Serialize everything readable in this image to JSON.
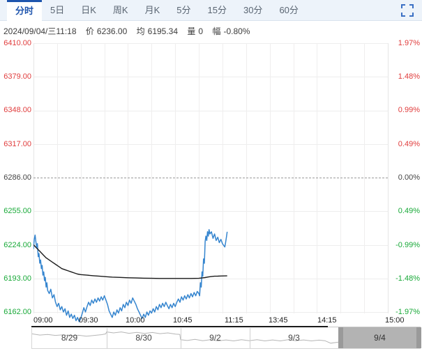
{
  "tab_bar": {
    "items": [
      {
        "label": "分时",
        "active": true
      },
      {
        "label": "5日",
        "active": false
      },
      {
        "label": "日K",
        "active": false
      },
      {
        "label": "周K",
        "active": false
      },
      {
        "label": "月K",
        "active": false
      },
      {
        "label": "5分",
        "active": false
      },
      {
        "label": "15分",
        "active": false
      },
      {
        "label": "30分",
        "active": false
      },
      {
        "label": "60分",
        "active": false
      }
    ]
  },
  "info_bar": {
    "datetime": "2024/09/04/三11:18",
    "price_label": "价",
    "price_value": "6236.00",
    "avg_label": "均",
    "avg_value": "6195.34",
    "volume_label": "量",
    "volume_value": "0",
    "range_label": "幅",
    "range_value": "-0.80%"
  },
  "colors": {
    "up": "#e03c3c",
    "down": "#18a938",
    "flat": "#444444",
    "price_line": "#3585cf",
    "avg_line": "#1a1a1a",
    "accent_blue": "#1f55ad",
    "tab_bar_bg": "#edf3fa",
    "nav_selected": "#b3b3b3",
    "nav_line": "#b5b5b5"
  },
  "chart_data": {
    "type": "line",
    "title": "",
    "x_ticks": [
      "09:00",
      "09:30",
      "10:00",
      "10:45",
      "11:15",
      "13:45",
      "14:15",
      "15:00"
    ],
    "tick_minutes": [
      0,
      30,
      60,
      90,
      120,
      150,
      180,
      225
    ],
    "x_total_trading_minutes": 225,
    "grid_interval_minutes": 15,
    "ylim": [
      6162,
      6410
    ],
    "base_price": 6286.0,
    "y_axis_prices": [
      {
        "value": "6410.00",
        "color": "#e03c3c"
      },
      {
        "value": "6379.00",
        "color": "#e03c3c"
      },
      {
        "value": "6348.00",
        "color": "#e03c3c"
      },
      {
        "value": "6317.00",
        "color": "#e03c3c"
      },
      {
        "value": "6286.00",
        "color": "#444444"
      },
      {
        "value": "6255.00",
        "color": "#18a938"
      },
      {
        "value": "6224.00",
        "color": "#18a938"
      },
      {
        "value": "6193.00",
        "color": "#18a938"
      },
      {
        "value": "6162.00",
        "color": "#18a938"
      }
    ],
    "y_axis_percents": [
      {
        "value": "1.97%",
        "color": "#e03c3c"
      },
      {
        "value": "1.48%",
        "color": "#e03c3c"
      },
      {
        "value": "0.99%",
        "color": "#e03c3c"
      },
      {
        "value": "0.49%",
        "color": "#e03c3c"
      },
      {
        "value": "0.00%",
        "color": "#444444"
      },
      {
        "value": "0.49%",
        "color": "#18a938"
      },
      {
        "value": "-0.99%",
        "color": "#18a938"
      },
      {
        "value": "-1.48%",
        "color": "#18a938"
      },
      {
        "value": "-1.97%",
        "color": "#18a938"
      }
    ],
    "current": {
      "time": "11:18",
      "price": 6236.0,
      "average": 6195.34,
      "volume": 0,
      "change_pct": -0.8
    },
    "series": [
      {
        "name": "price",
        "color": "#3585cf",
        "width": 1.5,
        "points": [
          [
            0,
            6220
          ],
          [
            0.5,
            6229
          ],
          [
            1,
            6233
          ],
          [
            1.5,
            6227
          ],
          [
            2,
            6222
          ],
          [
            2.5,
            6225
          ],
          [
            3,
            6213
          ],
          [
            3.5,
            6216
          ],
          [
            4,
            6207
          ],
          [
            4.5,
            6210
          ],
          [
            5,
            6202
          ],
          [
            5.5,
            6205
          ],
          [
            6,
            6196
          ],
          [
            6.5,
            6199
          ],
          [
            7,
            6191
          ],
          [
            7.5,
            6194
          ],
          [
            8,
            6185
          ],
          [
            8.5,
            6189
          ],
          [
            9,
            6182
          ],
          [
            10,
            6179
          ],
          [
            11,
            6183
          ],
          [
            12,
            6175
          ],
          [
            13,
            6178
          ],
          [
            14,
            6171
          ],
          [
            15,
            6167
          ],
          [
            16,
            6170
          ],
          [
            17,
            6164
          ],
          [
            18,
            6167
          ],
          [
            19,
            6162
          ],
          [
            20,
            6165
          ],
          [
            21,
            6159
          ],
          [
            22,
            6163
          ],
          [
            23,
            6157
          ],
          [
            24,
            6160
          ],
          [
            25,
            6156
          ],
          [
            26,
            6159
          ],
          [
            27,
            6154
          ],
          [
            28,
            6157
          ],
          [
            29,
            6153
          ],
          [
            30,
            6156
          ],
          [
            31,
            6161
          ],
          [
            32,
            6166
          ],
          [
            33,
            6162
          ],
          [
            34,
            6167
          ],
          [
            35,
            6171
          ],
          [
            36,
            6168
          ],
          [
            37,
            6173
          ],
          [
            38,
            6170
          ],
          [
            39,
            6174
          ],
          [
            40,
            6171
          ],
          [
            41,
            6175
          ],
          [
            42,
            6172
          ],
          [
            43,
            6176
          ],
          [
            44,
            6173
          ],
          [
            45,
            6177
          ],
          [
            46,
            6173
          ],
          [
            47,
            6169
          ],
          [
            48,
            6163
          ],
          [
            49,
            6160
          ],
          [
            50,
            6157
          ],
          [
            51,
            6162
          ],
          [
            52,
            6159
          ],
          [
            53,
            6164
          ],
          [
            54,
            6161
          ],
          [
            55,
            6166
          ],
          [
            56,
            6163
          ],
          [
            57,
            6169
          ],
          [
            58,
            6166
          ],
          [
            59,
            6171
          ],
          [
            60,
            6168
          ],
          [
            61,
            6173
          ],
          [
            62,
            6170
          ],
          [
            63,
            6175
          ],
          [
            64,
            6172
          ],
          [
            65,
            6169
          ],
          [
            66,
            6165
          ],
          [
            67,
            6162
          ],
          [
            68,
            6159
          ],
          [
            69,
            6156
          ],
          [
            70,
            6160
          ],
          [
            71,
            6157
          ],
          [
            72,
            6162
          ],
          [
            73,
            6159
          ],
          [
            74,
            6163
          ],
          [
            75,
            6161
          ],
          [
            76,
            6165
          ],
          [
            77,
            6162
          ],
          [
            78,
            6167
          ],
          [
            79,
            6164
          ],
          [
            80,
            6169
          ],
          [
            81,
            6166
          ],
          [
            82,
            6170
          ],
          [
            83,
            6167
          ],
          [
            84,
            6171
          ],
          [
            85,
            6168
          ],
          [
            86,
            6165
          ],
          [
            87,
            6169
          ],
          [
            88,
            6166
          ],
          [
            89,
            6170
          ],
          [
            90,
            6167
          ],
          [
            91,
            6171
          ],
          [
            92,
            6174
          ],
          [
            93,
            6171
          ],
          [
            94,
            6176
          ],
          [
            95,
            6173
          ],
          [
            96,
            6177
          ],
          [
            97,
            6174
          ],
          [
            98,
            6178
          ],
          [
            99,
            6175
          ],
          [
            100,
            6179
          ],
          [
            101,
            6176
          ],
          [
            102,
            6180
          ],
          [
            103,
            6177
          ],
          [
            104,
            6181
          ],
          [
            105,
            6179
          ],
          [
            105.5,
            6177
          ],
          [
            106,
            6189
          ],
          [
            106.5,
            6185
          ],
          [
            107,
            6199
          ],
          [
            107.5,
            6195
          ],
          [
            108,
            6211
          ],
          [
            108.5,
            6207
          ],
          [
            109,
            6227
          ],
          [
            109.5,
            6232
          ],
          [
            110,
            6228
          ],
          [
            110.5,
            6236
          ],
          [
            111,
            6232
          ],
          [
            111.5,
            6238
          ],
          [
            112,
            6234
          ],
          [
            113,
            6236
          ],
          [
            114,
            6230
          ],
          [
            115,
            6234
          ],
          [
            116,
            6228
          ],
          [
            117,
            6231
          ],
          [
            118,
            6226
          ],
          [
            119,
            6229
          ],
          [
            120,
            6225
          ],
          [
            121,
            6223
          ],
          [
            121.5,
            6222
          ],
          [
            122,
            6226
          ],
          [
            122.5,
            6231
          ],
          [
            123,
            6236
          ]
        ]
      },
      {
        "name": "average",
        "color": "#1a1a1a",
        "width": 1.4,
        "points": [
          [
            0,
            6224
          ],
          [
            2,
            6221
          ],
          [
            4,
            6218
          ],
          [
            6,
            6215
          ],
          [
            8,
            6212
          ],
          [
            10,
            6210
          ],
          [
            12,
            6208
          ],
          [
            14,
            6206
          ],
          [
            16,
            6204
          ],
          [
            18,
            6202
          ],
          [
            20,
            6201
          ],
          [
            22,
            6200
          ],
          [
            24,
            6199
          ],
          [
            26,
            6198
          ],
          [
            28,
            6197
          ],
          [
            30,
            6196.5
          ],
          [
            34,
            6196
          ],
          [
            38,
            6195.5
          ],
          [
            42,
            6195
          ],
          [
            46,
            6194.6
          ],
          [
            50,
            6194.2
          ],
          [
            55,
            6193.9
          ],
          [
            60,
            6193.6
          ],
          [
            65,
            6193.4
          ],
          [
            70,
            6193.2
          ],
          [
            75,
            6193.1
          ],
          [
            80,
            6193
          ],
          [
            85,
            6193
          ],
          [
            90,
            6193
          ],
          [
            95,
            6193
          ],
          [
            100,
            6193
          ],
          [
            105,
            6193.1
          ],
          [
            107,
            6193.4
          ],
          [
            109,
            6193.8
          ],
          [
            111,
            6194.3
          ],
          [
            113,
            6194.7
          ],
          [
            115,
            6195
          ],
          [
            117,
            6195.1
          ],
          [
            119,
            6195.2
          ],
          [
            121,
            6195.3
          ],
          [
            123,
            6195.34
          ]
        ]
      }
    ]
  },
  "navigator": {
    "days": [
      {
        "label": "8/29",
        "selected": false
      },
      {
        "label": "8/30",
        "selected": false
      },
      {
        "label": "9/2",
        "selected": false
      },
      {
        "label": "9/3",
        "selected": false
      },
      {
        "label": "9/4",
        "selected": true
      }
    ],
    "line_points": [
      [
        0,
        0.3
      ],
      [
        0.02,
        0.36
      ],
      [
        0.04,
        0.33
      ],
      [
        0.06,
        0.38
      ],
      [
        0.08,
        0.35
      ],
      [
        0.1,
        0.4
      ],
      [
        0.12,
        0.37
      ],
      [
        0.14,
        0.42
      ],
      [
        0.16,
        0.38
      ],
      [
        0.18,
        0.34
      ],
      [
        0.19,
        0.3
      ],
      [
        0.192,
        0.2
      ],
      [
        0.21,
        0.25
      ],
      [
        0.23,
        0.2
      ],
      [
        0.25,
        0.27
      ],
      [
        0.27,
        0.22
      ],
      [
        0.29,
        0.28
      ],
      [
        0.31,
        0.23
      ],
      [
        0.33,
        0.29
      ],
      [
        0.35,
        0.25
      ],
      [
        0.37,
        0.31
      ],
      [
        0.381,
        0.33
      ],
      [
        0.383,
        0.6
      ],
      [
        0.4,
        0.64
      ],
      [
        0.42,
        0.58
      ],
      [
        0.44,
        0.65
      ],
      [
        0.46,
        0.6
      ],
      [
        0.48,
        0.66
      ],
      [
        0.5,
        0.61
      ],
      [
        0.52,
        0.66
      ],
      [
        0.54,
        0.6
      ],
      [
        0.56,
        0.65
      ],
      [
        0.58,
        0.6
      ],
      [
        0.6,
        0.66
      ],
      [
        0.62,
        0.61
      ],
      [
        0.64,
        0.66
      ],
      [
        0.66,
        0.6
      ],
      [
        0.68,
        0.65
      ],
      [
        0.7,
        0.61
      ],
      [
        0.72,
        0.66
      ],
      [
        0.74,
        0.62
      ],
      [
        0.755,
        0.65
      ],
      [
        0.77,
        0.78
      ],
      [
        0.79,
        0.72
      ],
      [
        0.81,
        0.78
      ],
      [
        0.83,
        0.74
      ],
      [
        0.85,
        0.78
      ],
      [
        0.87,
        0.75
      ],
      [
        0.89,
        0.79
      ],
      [
        0.91,
        0.76
      ],
      [
        0.93,
        0.79
      ],
      [
        0.95,
        0.76
      ],
      [
        0.97,
        0.78
      ],
      [
        1,
        0.77
      ]
    ]
  }
}
